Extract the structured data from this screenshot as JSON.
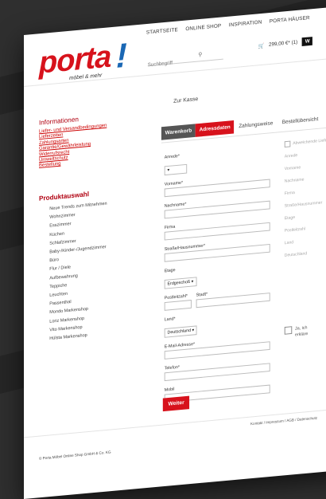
{
  "header": {
    "logo_word": "porta",
    "logo_bang": "!",
    "logo_sub": "möbel & mehr",
    "nav": [
      "STARTSEITE",
      "ONLINE SHOP",
      "INSPIRATION",
      "PORTA HÄUSER"
    ],
    "search_placeholder": "Suchbegriff",
    "cart_amount": "299,00 €* (1)",
    "cart_button": "W"
  },
  "sidebar": {
    "info_title": "Informationen",
    "info_links": [
      "Liefer- und Versandbedingungen",
      "Lieferzeiten",
      "Zahlungsarten",
      "Garantie/Gewährleistung",
      "Widerrufsrecht",
      "Umweltschutz",
      "Bestellung"
    ],
    "cats_title": "Produktauswahl",
    "cats": [
      "Neue Trends zum Mitnehmen",
      "Wohnzimmer",
      "Esszimmer",
      "Küchen",
      "Schlafzimmer",
      "Baby-/Kinder-/Jugendzimmer",
      "Büro",
      "Flur / Diele",
      "Aufbewahrung",
      "Teppiche",
      "Leuchten",
      "Passenthal",
      "Mondo Markenshop",
      "Loriz Markenshop",
      "Vito Markenshop",
      "Hülsta Markenshop"
    ]
  },
  "checkout": {
    "title": "Zur Kasse",
    "tabs": [
      "Warenkorb",
      "Adressdaten",
      "Zahlungsweise",
      "Bestellübersicht"
    ],
    "anrede_label": "Anrede*",
    "anrede_value": "",
    "vorname_label": "Vorname*",
    "nachname_label": "Nachname*",
    "firma_label": "Firma",
    "strasse_label": "Straße/Hausnummer*",
    "etage_label": "Etage",
    "etage_value": "Erdgeschoß",
    "plz_label": "Postleitzahl*",
    "ort_label": "Stadt*",
    "land_label": "Land*",
    "land_value": "Deutschland",
    "email_label": "E-Mail-Adresse*",
    "telefon_label": "Telefon*",
    "mobil_label": "Mobil",
    "weiter": "Weiter"
  },
  "right_col": {
    "checkbox_label": "Abweichende Lieferadresse",
    "faded": [
      "Anrede",
      "Vorname",
      "Nachname",
      "Firma",
      "Straße/Hausnummer",
      "Etage",
      "Postleitzahl",
      "Land",
      "Deutschland"
    ],
    "consent_lines": [
      "Ja, ich",
      "erkläre"
    ]
  },
  "footer": {
    "left": "© Porta Möbel Online Shop GmbH & Co. KG",
    "right": "Kontakt / Impressum / AGB / Datenschutz"
  }
}
